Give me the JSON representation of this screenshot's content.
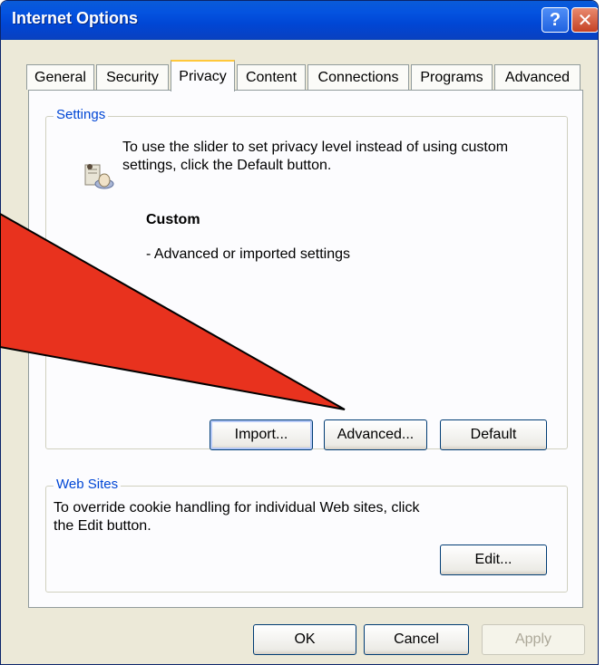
{
  "window": {
    "title": "Internet Options"
  },
  "tabs": [
    {
      "label": "General"
    },
    {
      "label": "Security"
    },
    {
      "label": "Privacy",
      "active": true
    },
    {
      "label": "Content"
    },
    {
      "label": "Connections"
    },
    {
      "label": "Programs"
    },
    {
      "label": "Advanced"
    }
  ],
  "settings": {
    "group_label": "Settings",
    "instruction": "To use the slider to set privacy level instead of using custom settings, click the Default button.",
    "level_title": "Custom",
    "level_description": "- Advanced or imported settings",
    "buttons": {
      "import": "Import...",
      "advanced": "Advanced...",
      "default": "Default"
    }
  },
  "websites": {
    "group_label": "Web Sites",
    "instruction": "To override cookie handling for individual Web sites, click the Edit button.",
    "edit_button": "Edit..."
  },
  "footer": {
    "ok": "OK",
    "cancel": "Cancel",
    "apply": "Apply"
  },
  "colors": {
    "annotation_arrow": "#e8321e",
    "title_bar": "#0453e0",
    "group_label": "#0046d5"
  },
  "icons": {
    "help": "question-mark",
    "close": "x-mark",
    "privacy": "privacy-icon"
  }
}
